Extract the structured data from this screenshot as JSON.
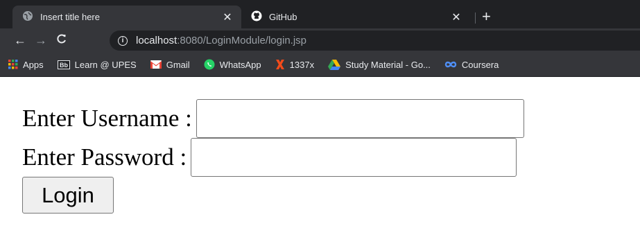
{
  "browser": {
    "tabs": [
      {
        "title": "Insert title here",
        "icon": "globe-icon",
        "active": true
      },
      {
        "title": "GitHub",
        "icon": "github-icon",
        "active": false
      }
    ],
    "tab_close_glyph": "✕",
    "new_tab_glyph": "+",
    "nav": {
      "back": "←",
      "forward": "→",
      "reload": "C"
    },
    "url": {
      "host": "localhost",
      "rest": ":8080/LoginModule/login.jsp"
    },
    "bookmarks": [
      {
        "label": "Apps",
        "icon": "apps-grid-icon"
      },
      {
        "label": "Learn @ UPES",
        "icon": "blackboard-icon"
      },
      {
        "label": "Gmail",
        "icon": "gmail-icon"
      },
      {
        "label": "WhatsApp",
        "icon": "whatsapp-icon"
      },
      {
        "label": "1337x",
        "icon": "1337x-icon"
      },
      {
        "label": "Study Material - Go...",
        "icon": "google-drive-icon"
      },
      {
        "label": "Coursera",
        "icon": "coursera-icon"
      }
    ]
  },
  "form": {
    "username_label": "Enter Username :",
    "username_value": "",
    "password_label": "Enter Password :",
    "password_value": "",
    "login_label": "Login"
  },
  "colors": {
    "tabstrip_bg": "#202124",
    "toolbar_bg": "#35363a",
    "text_light": "#e8eaed"
  }
}
